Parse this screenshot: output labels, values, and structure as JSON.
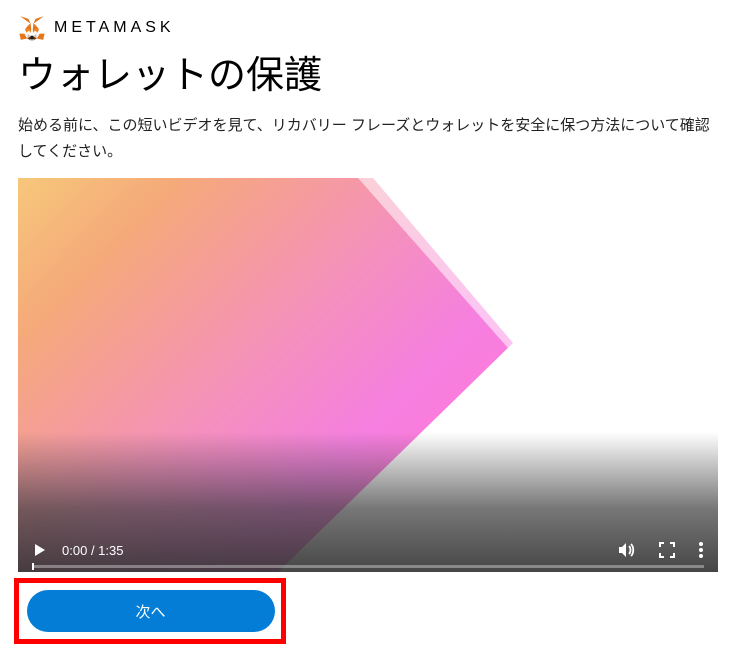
{
  "brand": "METAMASK",
  "title": "ウォレットの保護",
  "description": "始める前に、この短いビデオを見て、リカバリー フレーズとウォレットを安全に保つ方法について確認してください。",
  "video": {
    "current_time": "0:00",
    "duration": "1:35"
  },
  "actions": {
    "next_label": "次へ"
  }
}
